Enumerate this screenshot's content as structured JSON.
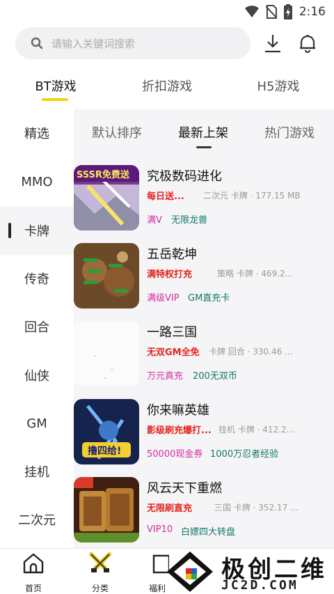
{
  "status_bar": {
    "time": "2:16"
  },
  "search": {
    "placeholder": "请输入关键词搜索"
  },
  "top_tabs": [
    {
      "label": "BT游戏",
      "active": true
    },
    {
      "label": "折扣游戏",
      "active": false
    },
    {
      "label": "H5游戏",
      "active": false
    }
  ],
  "categories": [
    {
      "label": "精选"
    },
    {
      "label": "MMO"
    },
    {
      "label": "卡牌",
      "active": true
    },
    {
      "label": "传奇"
    },
    {
      "label": "回合"
    },
    {
      "label": "仙侠"
    },
    {
      "label": "GM"
    },
    {
      "label": "挂机"
    },
    {
      "label": "二次元"
    }
  ],
  "sort_tabs": [
    {
      "label": "默认排序"
    },
    {
      "label": "最新上架",
      "active": true
    },
    {
      "label": "热门游戏"
    }
  ],
  "games": [
    {
      "name": "究极数码进化",
      "promo": "每日送...",
      "meta": "二次元 卡牌 · 177.15 MB",
      "tags": [
        "满V",
        "无限龙兽"
      ],
      "thumb_text": "SSSR免费送"
    },
    {
      "name": "五岳乾坤",
      "promo": "满特权打充",
      "meta": "策略 卡牌 · 469.2...",
      "tags": [
        "满级VIP",
        "GM直充卡"
      ],
      "thumb_text": ""
    },
    {
      "name": "一路三国",
      "promo": "无双GM全免",
      "meta": "卡牌 回合 · 330.46 ...",
      "tags": [
        "万元真充",
        "200无双币"
      ],
      "thumb_text": ""
    },
    {
      "name": "你来嘛英雄",
      "promo": "影级刷充爆打...",
      "meta": "挂机 卡牌 · 412.2...",
      "tags": [
        "50000现金券",
        "1000万忍者经验"
      ],
      "thumb_text": "撸四给!"
    },
    {
      "name": "风云天下重燃",
      "promo": "无限刷直充",
      "meta": "三国 卡牌 · 352.17 ...",
      "tags": [
        "VIP10",
        "白嫖四大转盘"
      ],
      "thumb_text": ""
    }
  ],
  "bottom_nav": [
    {
      "label": "首页",
      "icon": "home-icon"
    },
    {
      "label": "分类",
      "icon": "category-swords-icon"
    },
    {
      "label": "福利",
      "icon": "gift-icon"
    }
  ],
  "watermark": {
    "text": "极创二维",
    "url": "JC2D.COM"
  },
  "colors": {
    "accent": "#f2d30a",
    "promo_red": "#e6231e",
    "tag_pink": "#d12ea3",
    "tag_teal": "#11776a"
  }
}
